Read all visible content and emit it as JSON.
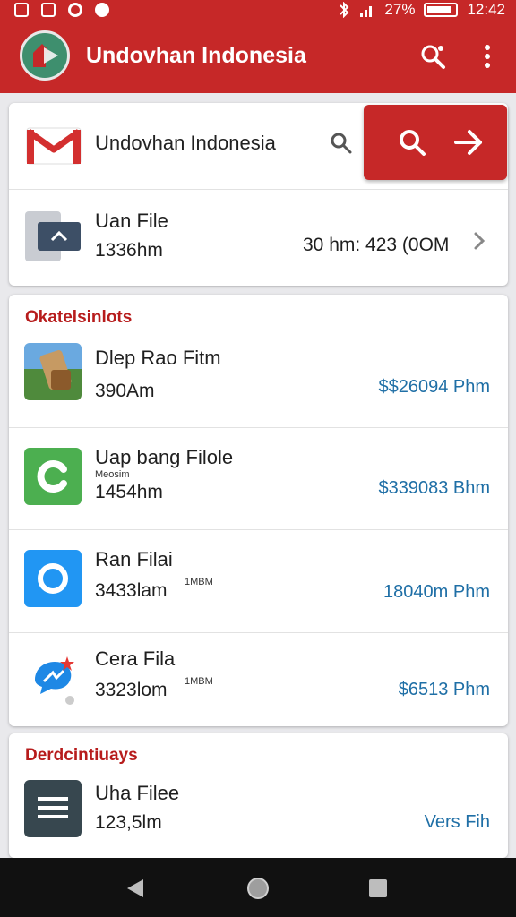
{
  "status_bar": {
    "battery": "27%",
    "time": "12:42"
  },
  "app_bar": {
    "title": "Undovhan Indonesia"
  },
  "search_card": {
    "label": "Undovhan Indonesia"
  },
  "file_card": {
    "title": "Uan File",
    "subtitle": "1336hm",
    "detail": "30 hm: 423 (0OM"
  },
  "section1": {
    "title": "Okatelsinlots",
    "items": [
      {
        "title": "Dlep Rao Fitm",
        "subtitle": "390Am",
        "tiny": "",
        "right": "$$26094 Phm",
        "icon": "game-icon"
      },
      {
        "title": "Uap bang Filole",
        "subtitle": "1454hm",
        "tiny": "Meosim",
        "right": "$339083 Bhm",
        "icon": "c-app-icon"
      },
      {
        "title": "Ran Filai",
        "subtitle": "3433lam",
        "tiny": "1MBM",
        "right": "18040m Phm",
        "icon": "ring-app-icon"
      },
      {
        "title": "Cera Fila",
        "subtitle": "3323lom",
        "tiny": "1MBM",
        "right": "$6513 Phm",
        "icon": "messenger-icon"
      }
    ]
  },
  "section2": {
    "title": "Derdcintiuays",
    "items": [
      {
        "title": "Uha Filee",
        "subtitle": "123,5lm",
        "right": "Vers Fih",
        "icon": "document-icon"
      }
    ]
  },
  "colors": {
    "primary": "#c62828",
    "section_title": "#b71c1c",
    "link": "#1f6fa6",
    "navbar": "#111111"
  }
}
